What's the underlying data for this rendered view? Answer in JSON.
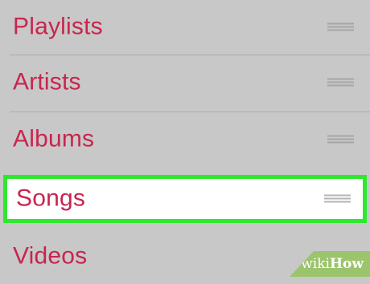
{
  "list": {
    "items": [
      {
        "label": "Playlists",
        "selected": false
      },
      {
        "label": "Artists",
        "selected": false
      },
      {
        "label": "Albums",
        "selected": false
      },
      {
        "label": "Songs",
        "selected": true
      },
      {
        "label": "Videos",
        "selected": false
      }
    ],
    "handle_icon": "drag-handle-icon"
  },
  "colors": {
    "label": "#c8254f",
    "background": "#c8c8c8",
    "highlight_border": "#2ee82e",
    "watermark": "#9bc46c"
  },
  "watermark": {
    "prefix": "wiki",
    "suffix": "How"
  }
}
